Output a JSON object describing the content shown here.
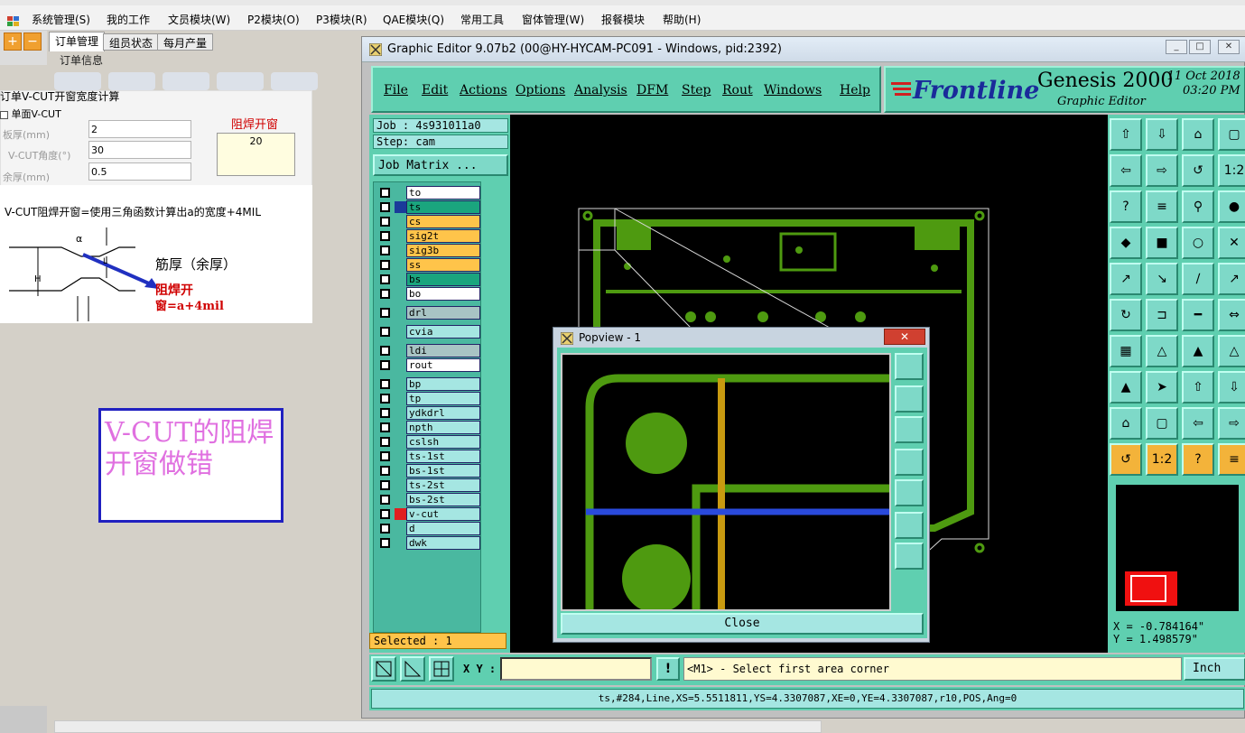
{
  "app": {
    "menu": [
      "系统管理(S)",
      "我的工作",
      "文员模块(W)",
      "P2模块(O)",
      "P3模块(R)",
      "QAE模块(Q)",
      "常用工具",
      "窗体管理(W)",
      "报餐模块",
      "帮助(H)"
    ],
    "tabs": [
      "订单管理",
      "组员状态",
      "每月产量"
    ],
    "order_info": "订单信息",
    "calc": {
      "title": "订单V-CUT开窗宽度计算",
      "single_vcut": "单面V-CUT",
      "board_label": "板厚(mm)",
      "board_value": "2",
      "angle_label": "V-CUT角度(°)",
      "angle_value": "30",
      "remain_label": "余厚(mm)",
      "remain_value": "0.5",
      "mask_label": "阻焊开窗",
      "mask_value": "20",
      "formula": "V-CUT阻焊开窗=使用三角函数计算出a的宽度+4MIL",
      "sketch_alpha": "α",
      "sketch_h": "H",
      "sketch_l": "L",
      "sketch_remain": "筋厚（余厚）",
      "sketch_red1": "阻焊开",
      "sketch_red2": "窗=a+4mil"
    },
    "annotation": "V-CUT的阻焊开窗做错"
  },
  "genesis": {
    "title": "Graphic Editor 9.07b2 (00@HY-HYCAM-PC091 - Windows, pid:2392)",
    "menu": [
      "File",
      "Edit",
      "Actions",
      "Options",
      "Analysis",
      "DFM",
      "Step",
      "Rout",
      "Windows",
      "Help"
    ],
    "logo": "Frontline",
    "product": "Genesis 2000",
    "product_sub": "Graphic Editor",
    "date": "11 Oct 2018",
    "time": "03:20 PM",
    "job": "Job : 4s931011a0",
    "step": "Step: cam",
    "job_matrix": "Job Matrix ...",
    "layers": [
      {
        "name": "to",
        "color": "#ffffff",
        "group": 0
      },
      {
        "name": "ts",
        "color": "#1aa57e",
        "group": 0,
        "mark": "#1a3a9a"
      },
      {
        "name": "cs",
        "color": "#ffc44a",
        "group": 0
      },
      {
        "name": "sig2t",
        "color": "#ffc44a",
        "group": 0
      },
      {
        "name": "sig3b",
        "color": "#ffc44a",
        "group": 0
      },
      {
        "name": "ss",
        "color": "#ffc44a",
        "group": 0
      },
      {
        "name": "bs",
        "color": "#1aa57e",
        "group": 0
      },
      {
        "name": "bo",
        "color": "#ffffff",
        "group": 0
      },
      {
        "name": "drl",
        "color": "#a8c4c4",
        "group": 1
      },
      {
        "name": "cvia",
        "color": "#a5e6e2",
        "group": 2
      },
      {
        "name": "ldi",
        "color": "#a8c4c4",
        "group": 3
      },
      {
        "name": "rout",
        "color": "#ffffff",
        "group": 3
      },
      {
        "name": "bp",
        "color": "#a5e6e2",
        "group": 4
      },
      {
        "name": "tp",
        "color": "#a5e6e2",
        "group": 4
      },
      {
        "name": "ydkdrl",
        "color": "#a5e6e2",
        "group": 4
      },
      {
        "name": "npth",
        "color": "#a5e6e2",
        "group": 4
      },
      {
        "name": "cslsh",
        "color": "#a5e6e2",
        "group": 4
      },
      {
        "name": "ts-1st",
        "color": "#a5e6e2",
        "group": 4
      },
      {
        "name": "bs-1st",
        "color": "#a5e6e2",
        "group": 4
      },
      {
        "name": "ts-2st",
        "color": "#a5e6e2",
        "group": 4
      },
      {
        "name": "bs-2st",
        "color": "#a5e6e2",
        "group": 4
      },
      {
        "name": "v-cut",
        "color": "#a5e6e2",
        "group": 4,
        "mark": "#e02020"
      },
      {
        "name": "d",
        "color": "#a5e6e2",
        "group": 4
      },
      {
        "name": "dwk",
        "color": "#a5e6e2",
        "group": 4
      }
    ],
    "selected": "Selected : 1",
    "xy_label": "X Y :",
    "prompt": "<M1> - Select first area corner",
    "units": "Inch",
    "coord_x": "X = -0.784164\"",
    "coord_y": "Y = 1.498579\"",
    "status": "ts,#284,Line,XS=5.5511811,YS=4.3307087,XE=0,YE=4.3307087,r10,POS,Ang=0",
    "popview_title": "Popview - 1",
    "popview_close": "Close",
    "tool_rows": 10
  }
}
